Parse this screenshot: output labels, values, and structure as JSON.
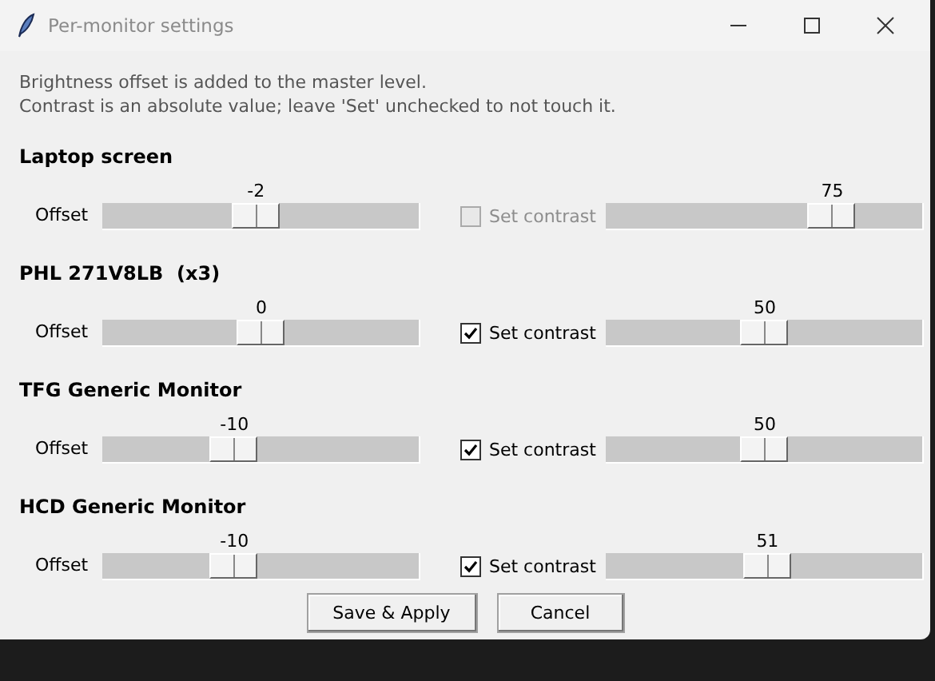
{
  "window": {
    "title": "Per-monitor settings"
  },
  "intro": [
    "Brightness offset is added to the master level.",
    "Contrast is an absolute value; leave 'Set' unchecked to not touch it."
  ],
  "monitors": [
    {
      "name": "Laptop screen",
      "offset_label": "Offset",
      "offset": {
        "reading": "-2",
        "level": 0.48
      },
      "set_contrast": {
        "label": "Set contrast",
        "checked": false,
        "disabled": true
      },
      "contrast": {
        "reading": "75",
        "level": 0.75
      }
    },
    {
      "name": "PHL 271V8LB  (x3)",
      "offset_label": "Offset",
      "offset": {
        "reading": "0",
        "level": 0.5
      },
      "set_contrast": {
        "label": "Set contrast",
        "checked": true,
        "disabled": false
      },
      "contrast": {
        "reading": "50",
        "level": 0.5
      }
    },
    {
      "name": "TFG Generic Monitor",
      "offset_label": "Offset",
      "offset": {
        "reading": "-10",
        "level": 0.4
      },
      "set_contrast": {
        "label": "Set contrast",
        "checked": true,
        "disabled": false
      },
      "contrast": {
        "reading": "50",
        "level": 0.5
      }
    },
    {
      "name": "HCD Generic Monitor",
      "offset_label": "Offset",
      "offset": {
        "reading": "-10",
        "level": 0.4
      },
      "set_contrast": {
        "label": "Set contrast",
        "checked": true,
        "disabled": false
      },
      "contrast": {
        "reading": "51",
        "level": 0.51
      }
    }
  ],
  "buttons": [
    "Save & Apply",
    "Cancel"
  ]
}
